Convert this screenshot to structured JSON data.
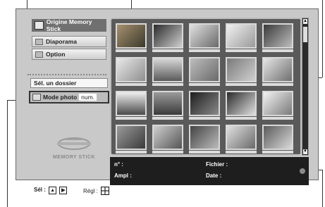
{
  "menu": {
    "memory_stick_source": "Origine Memory Stick",
    "slideshow": "Diaporama",
    "option": "Option",
    "select_folder": "Sél. un dossier",
    "photo_number_mode_1": "Mode photo",
    "photo_number_mode_2": "num."
  },
  "logo_text": "MEMORY STICK",
  "info_panel": {
    "number_label": "n° :",
    "file_label": "Fichier :",
    "ampl_label": "Ampl :",
    "date_label": "Date :"
  },
  "hints": {
    "select_label": "Sél :",
    "set_label": "Régl :"
  },
  "icons": {
    "scroll_up": "▲",
    "scroll_down": "▼",
    "arrow_up": "▲",
    "arrow_right": "▶"
  }
}
